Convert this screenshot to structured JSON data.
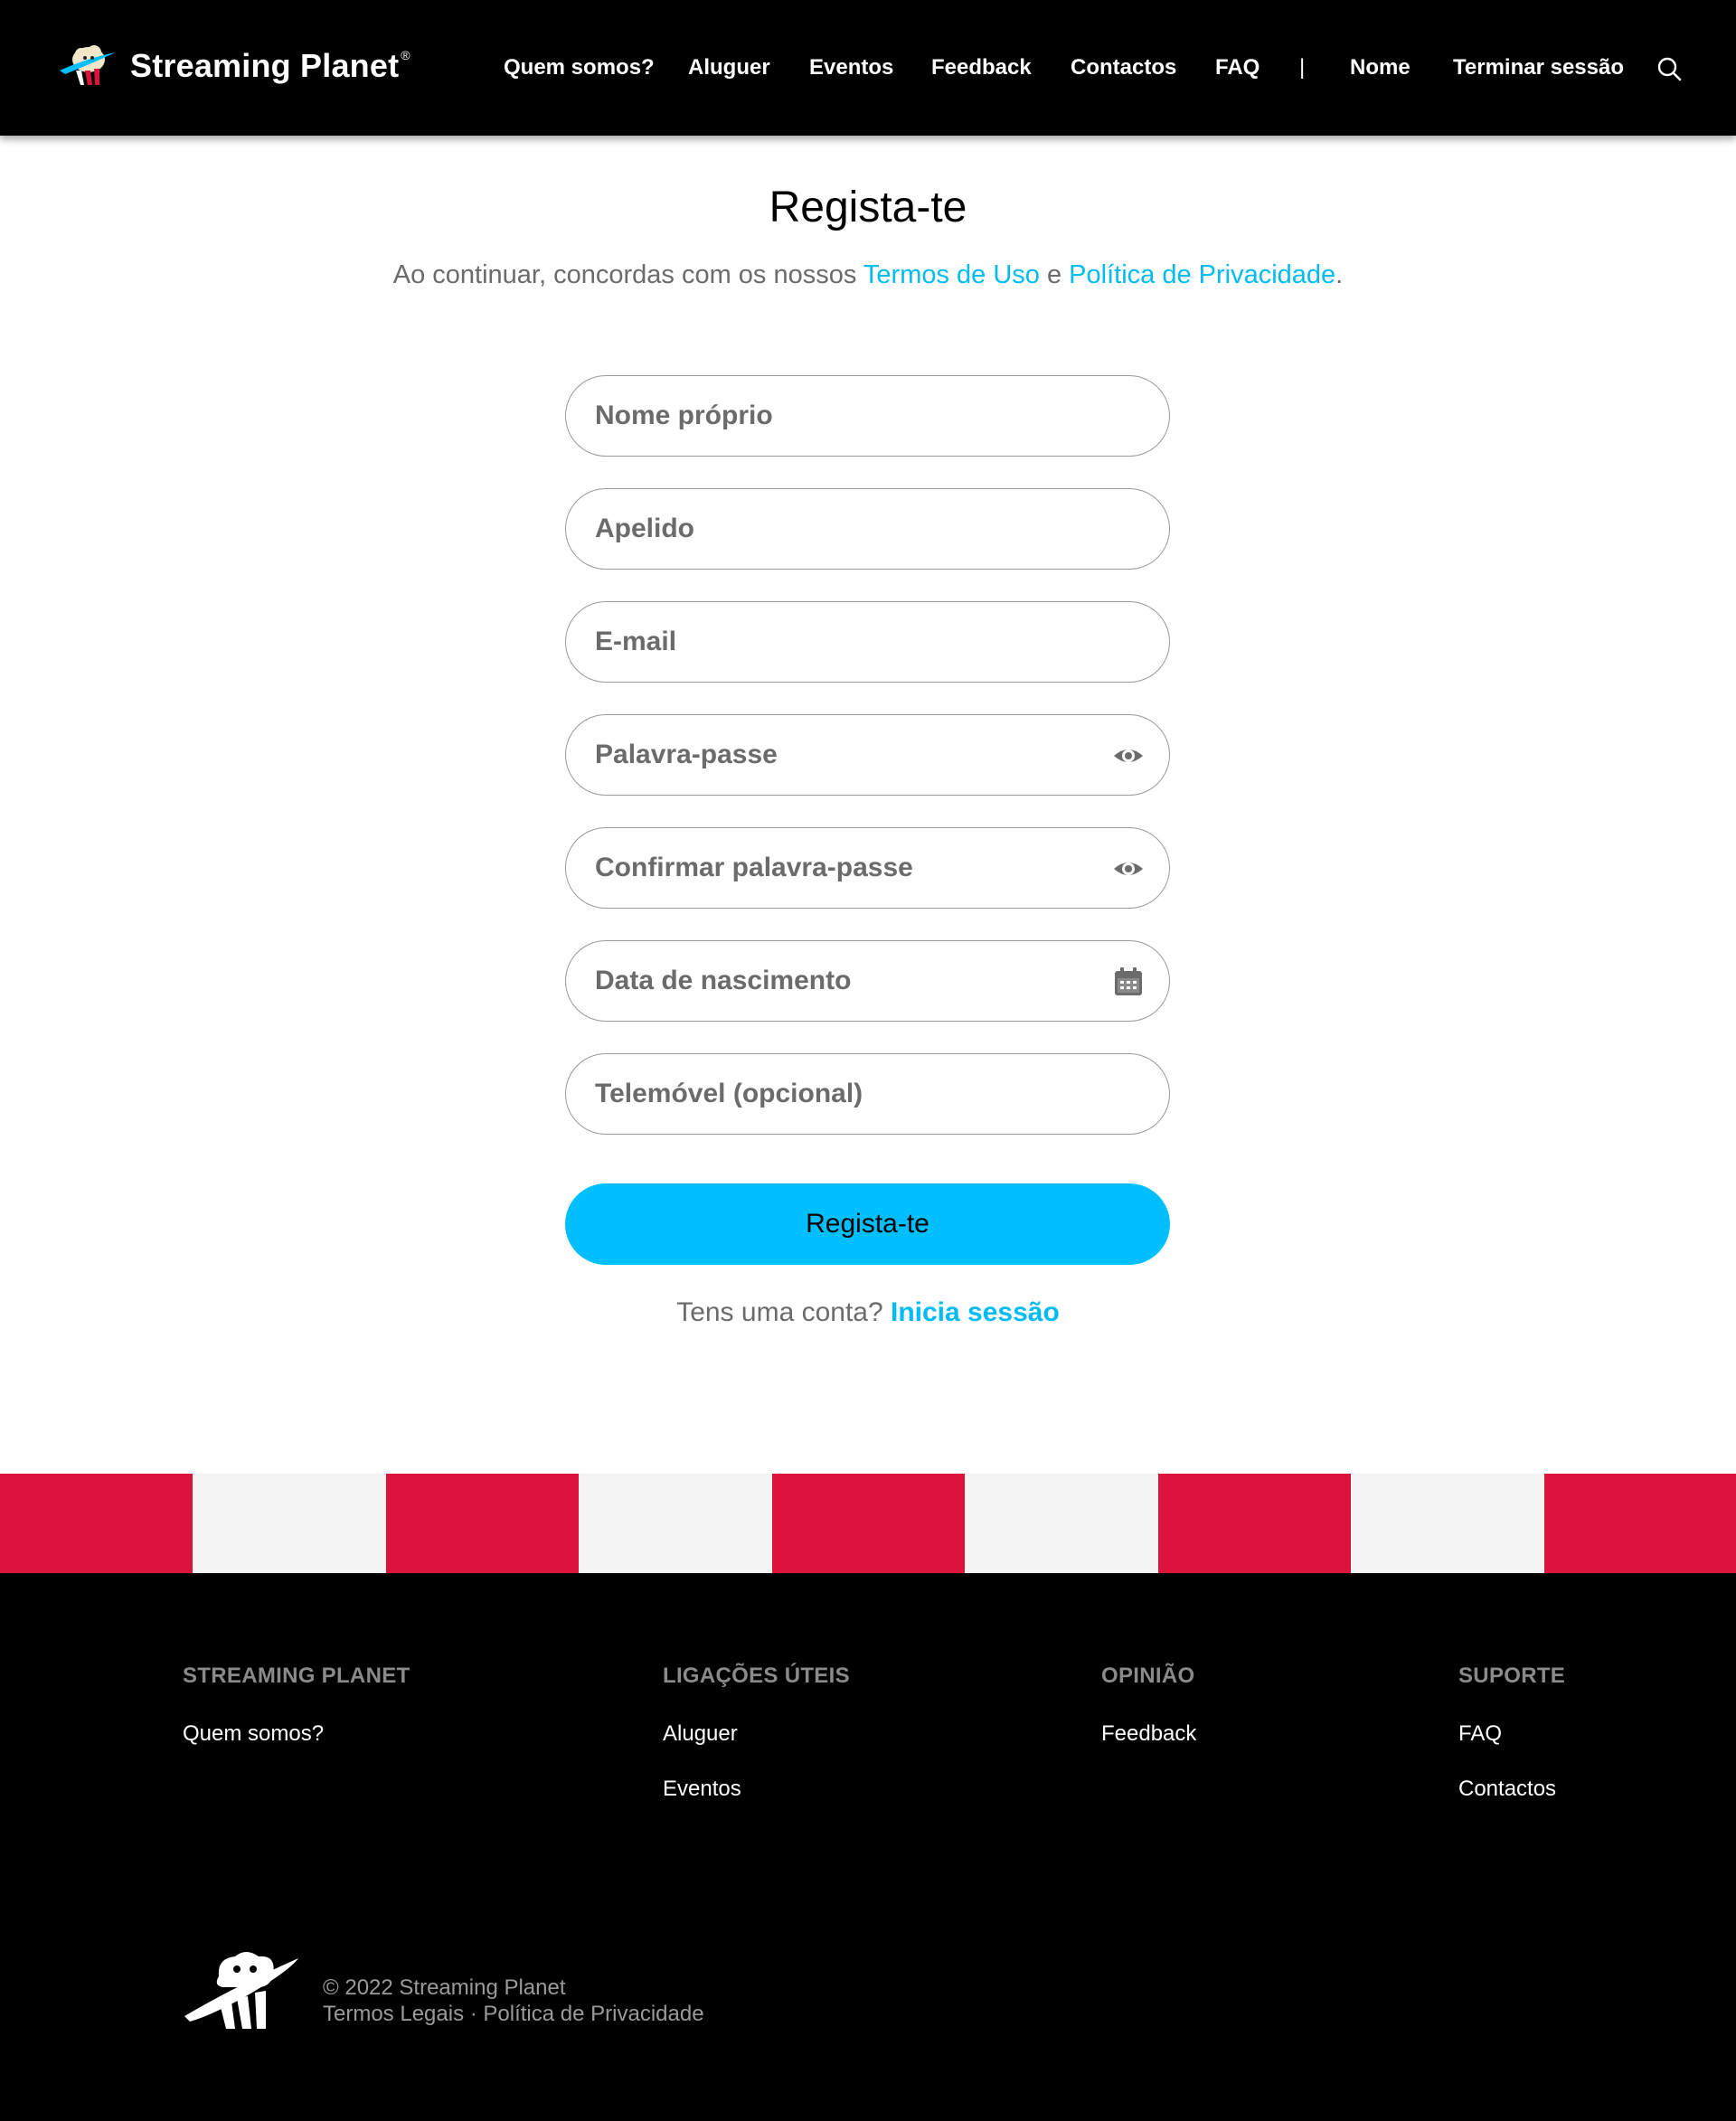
{
  "header": {
    "brand_name": "Streaming Planet",
    "brand_reg": "®",
    "nav": [
      "Quem somos?",
      "Aluguer",
      "Eventos",
      "Feedback",
      "Contactos",
      "FAQ"
    ],
    "separator": "|",
    "user_name": "Nome",
    "logout": "Terminar sessão"
  },
  "main": {
    "title": "Regista-te",
    "terms_prefix": "Ao continuar, concordas com os nossos ",
    "terms_link": "Termos de Uso",
    "terms_and": " e ",
    "privacy_link": "Política de Privacidade",
    "terms_suffix": ".",
    "fields": {
      "first_name": "Nome próprio",
      "last_name": "Apelido",
      "email": "E-mail",
      "password": "Palavra-passe",
      "confirm_password": "Confirmar palavra-passe",
      "birth_date": "Data de nascimento",
      "phone": "Telemóvel (opcional)"
    },
    "submit_label": "Regista-te",
    "have_account": "Tens uma conta? ",
    "login_link": "Inicia sessão"
  },
  "footer": {
    "columns": [
      {
        "heading": "STREAMING PLANET",
        "links": [
          "Quem somos?"
        ]
      },
      {
        "heading": "LIGAÇÕES ÚTEIS",
        "links": [
          "Aluguer",
          "Eventos"
        ]
      },
      {
        "heading": "OPINIÃO",
        "links": [
          "Feedback"
        ]
      },
      {
        "heading": "SUPORTE",
        "links": [
          "FAQ",
          "Contactos"
        ]
      }
    ],
    "copyright": "© 2022 Streaming Planet",
    "legal_terms": "Termos Legais",
    "legal_sep": " · ",
    "legal_privacy": "Política de Privacidade"
  },
  "colors": {
    "accent": "#00bfff",
    "link": "#00bcf2",
    "stripe_red": "#dc143c",
    "stripe_light": "#f4f4f4",
    "header_bg": "#000000"
  },
  "icons": {
    "search": "search-icon",
    "password_toggle": "eye-icon",
    "calendar": "calendar-icon"
  }
}
